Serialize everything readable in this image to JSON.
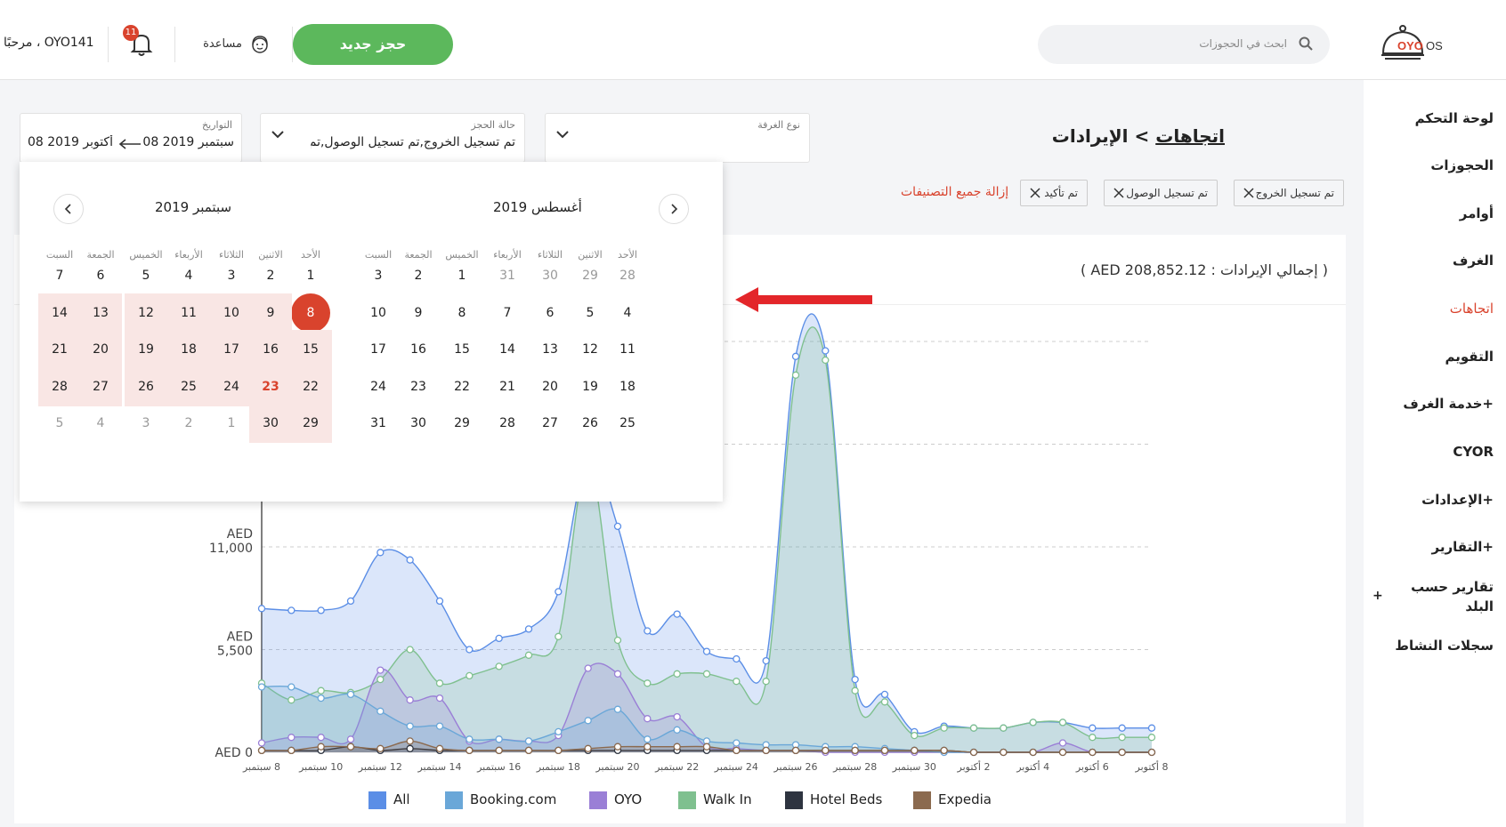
{
  "header": {
    "logo_text": "OYO OS",
    "search_placeholder": "ابحث في الحجوزات",
    "new_booking": "حجز جديد",
    "help": "مساعدة",
    "notifications_count": "11",
    "greeting": "مرحبًا ، OYO141"
  },
  "sidebar": {
    "items": [
      {
        "label": "لوحة التحكم",
        "plus": ""
      },
      {
        "label": "الحجوزات",
        "plus": ""
      },
      {
        "label": "أوامر",
        "plus": ""
      },
      {
        "label": "الغرف",
        "plus": ""
      },
      {
        "label": "اتجاهات",
        "plus": ""
      },
      {
        "label": "التقويم",
        "plus": ""
      },
      {
        "label": "خدمة الغرف+",
        "plus": ""
      },
      {
        "label": "CYOR",
        "plus": ""
      },
      {
        "label": "الإعدادات+",
        "plus": ""
      },
      {
        "label": "التقارير+",
        "plus": ""
      },
      {
        "label": "تقارير حسب",
        "label2": "البلد",
        "plus": "+"
      },
      {
        "label": "سجلات النشاط",
        "plus": ""
      }
    ],
    "active_index": 4
  },
  "page": {
    "title_link": "اتجاهات",
    "title_rest": " > الإيرادات"
  },
  "filters": {
    "room_type": {
      "label": "نوع الغرفة",
      "value": ""
    },
    "booking_status": {
      "label": "حالة الحجز",
      "value": "تم تسجيل الخروج,تم تسجيل الوصول,تم تأكيد"
    },
    "dates": {
      "label": "التواريخ",
      "from": "08 سبتمبر 2019",
      "to": "08 أكتوبر 2019"
    }
  },
  "chips": [
    "تم تسجيل الخروج",
    "تم تسجيل الوصول",
    "تم تأكيد"
  ],
  "clear_all": "إزالة جميع التصنيفات",
  "revenue_total": "( إجمالي الإيرادات : AED 208,852.12 )",
  "calendar": {
    "left_title": "سبتمبر 2019",
    "right_title": "أغسطس 2019",
    "weekdays": [
      "الأحد",
      "الاثنين",
      "الثلاثاء",
      "الأربعاء",
      "الخميس",
      "الجمعة",
      "السبت"
    ],
    "september": [
      [
        "1",
        "2",
        "3",
        "4",
        "5",
        "6",
        "7"
      ],
      [
        "8",
        "9",
        "10",
        "11",
        "12",
        "13",
        "14"
      ],
      [
        "15",
        "16",
        "17",
        "18",
        "19",
        "20",
        "21"
      ],
      [
        "22",
        "23",
        "24",
        "25",
        "26",
        "27",
        "28"
      ],
      [
        "29",
        "30",
        "1",
        "2",
        "3",
        "4",
        "5"
      ]
    ],
    "august": [
      [
        "28",
        "29",
        "30",
        "31",
        "1",
        "2",
        "3"
      ],
      [
        "4",
        "5",
        "6",
        "7",
        "8",
        "9",
        "10"
      ],
      [
        "11",
        "12",
        "13",
        "14",
        "15",
        "16",
        "17"
      ],
      [
        "18",
        "19",
        "20",
        "21",
        "22",
        "23",
        "24"
      ],
      [
        "25",
        "26",
        "27",
        "28",
        "29",
        "30",
        "31"
      ]
    ]
  },
  "colors": {
    "accent_red": "#d9432d",
    "green_button": "#5cb85c",
    "all": "#5b8ee6",
    "booking": "#6aa7d8",
    "oyo": "#9a7fd6",
    "walkin": "#7fc08f",
    "hotelbeds": "#2e3440",
    "expedia": "#8b6a4f"
  },
  "chart_data": {
    "type": "area",
    "ylabels": [
      "AED 0",
      "AED 5,500",
      "AED 11,000"
    ],
    "y_ticks": [
      0,
      5500,
      11000
    ],
    "ylim": [
      0,
      22000
    ],
    "x_ticks": [
      "8 سبتمبر",
      "10 سبتمبر",
      "12 سبتمبر",
      "14 سبتمبر",
      "16 سبتمبر",
      "18 سبتمبر",
      "20 سبتمبر",
      "22 سبتمبر",
      "24 سبتمبر",
      "26 سبتمبر",
      "28 سبتمبر",
      "30 سبتمبر",
      "2 أكتوبر",
      "4 أكتوبر",
      "6 أكتوبر",
      "8 أكتوبر"
    ],
    "n_points": 31,
    "series": [
      {
        "name": "All",
        "color": "#5b8ee6",
        "values": [
          7700,
          7600,
          7600,
          8100,
          10700,
          10300,
          8100,
          5500,
          6100,
          6600,
          8600,
          15800,
          12100,
          6500,
          7400,
          5400,
          5000,
          4900,
          21200,
          21500,
          3900,
          3100,
          1100,
          1400,
          1300,
          1300,
          1600,
          1600,
          1300,
          1300,
          1300
        ]
      },
      {
        "name": "Booking.com",
        "color": "#6aa7d8",
        "values": [
          3500,
          3500,
          2900,
          3100,
          2200,
          1400,
          1400,
          700,
          700,
          600,
          1100,
          1700,
          2300,
          700,
          1200,
          600,
          500,
          400,
          400,
          300,
          300,
          200,
          100,
          0,
          0,
          0,
          0,
          0,
          0,
          0,
          0
        ]
      },
      {
        "name": "OYO",
        "color": "#9a7fd6",
        "values": [
          500,
          800,
          800,
          700,
          4400,
          2800,
          2900,
          600,
          700,
          600,
          900,
          4500,
          4200,
          1800,
          1900,
          300,
          200,
          100,
          100,
          0,
          0,
          0,
          0,
          0,
          0,
          0,
          0,
          500,
          0,
          0,
          0
        ]
      },
      {
        "name": "Walk In",
        "color": "#7fc08f",
        "values": [
          3700,
          2800,
          3300,
          3200,
          3900,
          5500,
          3700,
          4100,
          4600,
          5200,
          6200,
          15600,
          6000,
          3700,
          4200,
          4200,
          3800,
          3800,
          20200,
          21000,
          3300,
          2700,
          900,
          1300,
          1300,
          1300,
          1600,
          1600,
          800,
          800,
          800
        ]
      },
      {
        "name": "Hotel Beds",
        "color": "#2e3440",
        "values": [
          100,
          100,
          100,
          300,
          100,
          200,
          100,
          100,
          100,
          100,
          100,
          100,
          100,
          100,
          100,
          100,
          100,
          100,
          100,
          100,
          100,
          100,
          100,
          100,
          0,
          0,
          0,
          0,
          0,
          0,
          0
        ]
      },
      {
        "name": "Expedia",
        "color": "#8b6a4f",
        "values": [
          100,
          100,
          300,
          300,
          200,
          600,
          200,
          100,
          100,
          100,
          100,
          200,
          300,
          300,
          300,
          300,
          100,
          100,
          100,
          100,
          100,
          100,
          100,
          100,
          0,
          0,
          0,
          0,
          0,
          0,
          0
        ]
      }
    ]
  }
}
